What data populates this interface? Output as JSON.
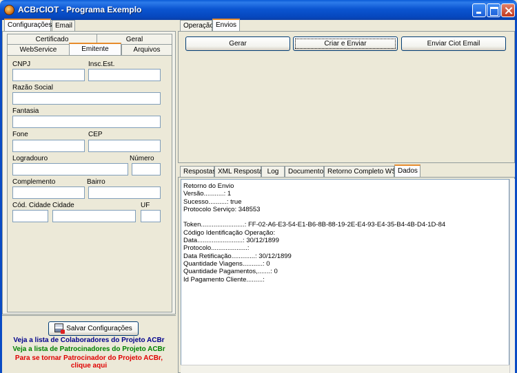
{
  "window": {
    "title": "ACBrCIOT - Programa Exemplo"
  },
  "left_tabs": [
    "Configurações",
    "Email"
  ],
  "config_tabs_row1": [
    "Certificado",
    "Geral"
  ],
  "config_tabs_row2": [
    "WebService",
    "Emitente",
    "Arquivos"
  ],
  "emitente": {
    "cnpj_label": "CNPJ",
    "insc_est_label": "Insc.Est.",
    "razao_social_label": "Razão Social",
    "fantasia_label": "Fantasia",
    "fone_label": "Fone",
    "cep_label": "CEP",
    "logradouro_label": "Logradouro",
    "numero_label": "Número",
    "complemento_label": "Complemento",
    "bairro_label": "Bairro",
    "cod_cidade_label": "Cód. Cidade",
    "cidade_label": "Cidade",
    "uf_label": "UF"
  },
  "save_button_label": "Salvar Configurações",
  "links": {
    "colaboradores": "Veja a lista de Colaboradores do Projeto ACBr",
    "patrocinadores": "Veja a lista de Patrocinadores do Projeto ACBr",
    "tornar_patrocinador_line1": "Para se tornar Patrocinador do Projeto ACBr,",
    "tornar_patrocinador_line2": "clique aqui"
  },
  "right_tabs": [
    "Operação",
    "Envios"
  ],
  "actions": {
    "gerar": "Gerar",
    "criar_enviar": "Criar e Enviar",
    "enviar_email": "Enviar Ciot Email"
  },
  "result_tabs": [
    "Respostas",
    "XML Resposta",
    "Log",
    "Documento",
    "Retorno Completo WS",
    "Dados"
  ],
  "result_text": "Retorno do Envio\nVersão...........: 1\nSucesso..........: true\nProtocolo Serviço: 348553\n\nToken........................: FF-02-A6-E3-54-E1-B6-8B-88-19-2E-E4-93-E4-35-B4-4B-D4-1D-84\nCódigo Identificação Operação:\nData.........................: 30/12/1899\nProtocolo....................:\nData Retificação.............: 30/12/1899\nQuantidade Viagens...........: 0\nQuantidade Pagamentos,.......: 0\nId Pagamento Cliente.........:",
  "colors": {
    "link_blue": "#00008B",
    "link_green": "#008000",
    "link_red": "#E00000",
    "titlebar": "#0A4BC4"
  }
}
